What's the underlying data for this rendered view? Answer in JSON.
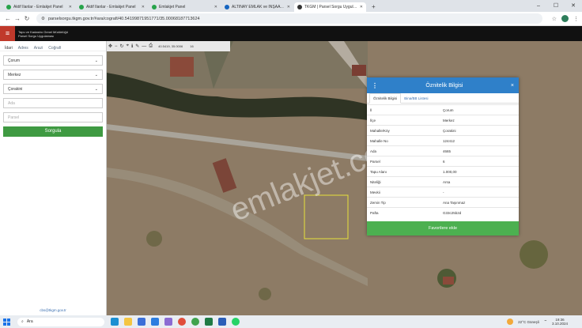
{
  "browser": {
    "tabs": [
      {
        "label": "Aktif İlanlar - Emlakjet Panel",
        "color": "#27a34a",
        "active": false
      },
      {
        "label": "Aktif İlanlar - Emlakjet Panel",
        "color": "#27a34a",
        "active": false
      },
      {
        "label": "Emlakjet Panel",
        "color": "#27a34a",
        "active": false
      },
      {
        "label": "ALTINAY EMLAK ve İNŞAAT | İ...",
        "color": "#1565c0",
        "active": false
      },
      {
        "label": "TKGM | Parsel Sorgu Uygulama...",
        "color": "#333333",
        "active": true
      }
    ],
    "url": "parselsorgu.tkgm.gov.tr/#ara/cografi/40.54199871951771/35.00068187713624"
  },
  "app": {
    "brand_line1": "Tapu ve Kadastro Genel Müdürlüğü",
    "brand_line2": "Parsel Sorgu Uygulaması"
  },
  "left_panel": {
    "tabs": [
      "İdari",
      "Adres",
      "Arazi",
      "Coğrafi"
    ],
    "fields": [
      "Çorum",
      "Merkez",
      "Çorakini",
      "Ada",
      "Parsel"
    ],
    "query_button": "Sorgula",
    "email": "cbs@tkgm.gov.tr"
  },
  "map": {
    "coordinates": "40.5419, 35.0006",
    "zoom": "16",
    "watermark": "emlakjet.com"
  },
  "dialog": {
    "title": "Öznitelik Bilgisi",
    "tabs": [
      "Öznitelik Bilgisi",
      "Bina/BB Listesi"
    ],
    "rows": [
      {
        "key": "İl",
        "value": "Çorum"
      },
      {
        "key": "İlçe",
        "value": "Merkez"
      },
      {
        "key": "Mahalle/Köy",
        "value": "Çorakini"
      },
      {
        "key": "Mahalle No",
        "value": "124412"
      },
      {
        "key": "Ada",
        "value": "4665"
      },
      {
        "key": "Parsel",
        "value": "6"
      },
      {
        "key": "Tapu Alanı",
        "value": "1.000,00"
      },
      {
        "key": "Niteliği",
        "value": "Arsa"
      },
      {
        "key": "Mevkii",
        "value": "-"
      },
      {
        "key": "Zemin Tip",
        "value": "Ana Taşınmaz"
      },
      {
        "key": "Pafta",
        "value": "G33c25b2d"
      }
    ],
    "favorite_button": "Favorilere ekle"
  },
  "taskbar": {
    "search": "Ara",
    "weather": "22°C  Güneşli",
    "time": "19:36",
    "date": "3.10.2024"
  }
}
